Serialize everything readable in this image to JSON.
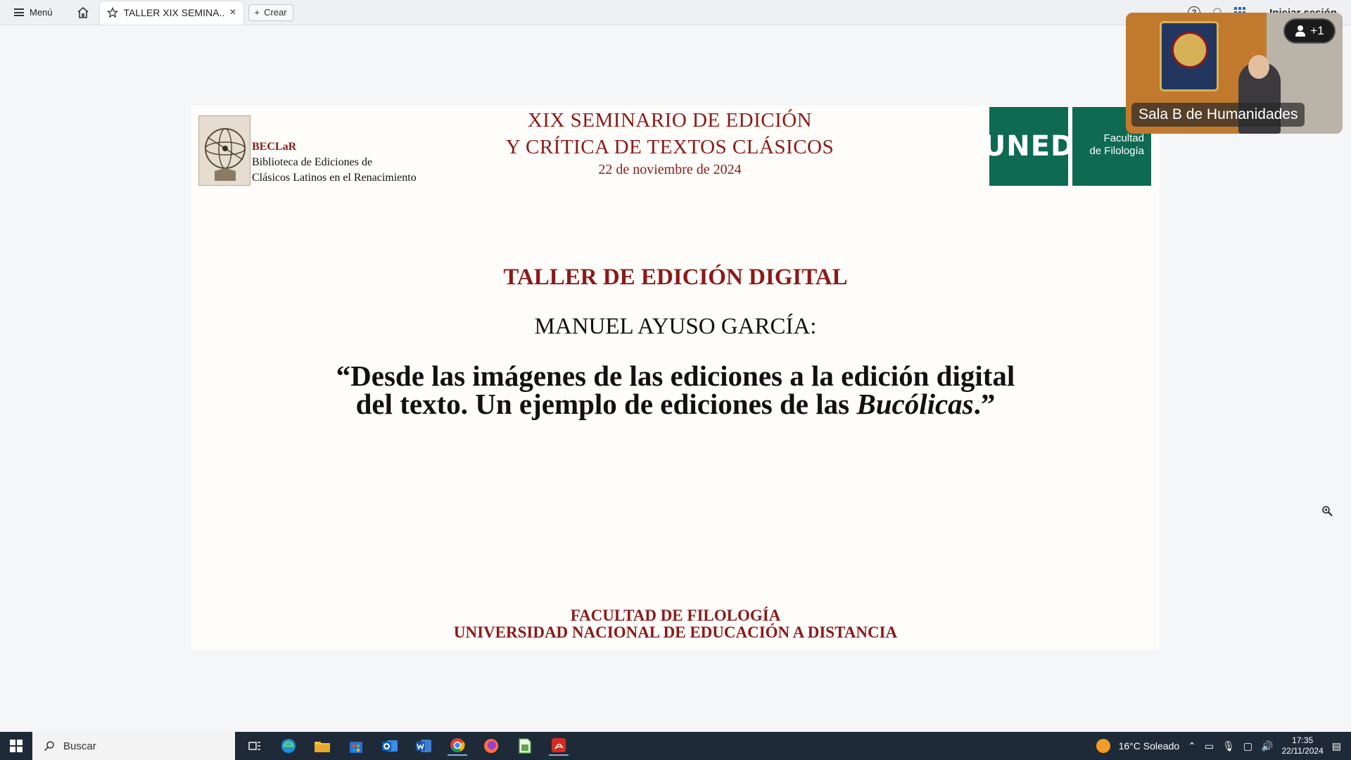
{
  "topbar": {
    "menu_label": "Menú",
    "tab_title": "TALLER XIX SEMINA...",
    "create_label": "Crear",
    "login_label": "Iniciar sesión"
  },
  "slide": {
    "beclar_name": "BECLaR",
    "beclar_line1": "Biblioteca de Ediciones de",
    "beclar_line2": "Clásicos Latinos en el Renacimiento",
    "seminar_line1": "XIX SEMINARIO DE EDICIÓN",
    "seminar_line2": "Y CRÍTICA DE TEXTOS CLÁSICOS",
    "seminar_date": "22 de noviembre de 2024",
    "uned_logo": "UNED",
    "facultad_line1": "Facultad",
    "facultad_line2": "de Filología",
    "workshop_title": "TALLER DE EDICIÓN DIGITAL",
    "speaker": "MANUEL AYUSO GARCÍA:",
    "talk_line1": "“Desde las imágenes de las ediciones a la edición digital",
    "talk_line2_pre": "del texto. Un ejemplo de ediciones de las ",
    "talk_line2_italic": "Bucólicas",
    "talk_line2_post": ".”",
    "footer_line1": "FACULTAD DE FILOLOGÍA",
    "footer_line2": "UNIVERSIDAD NACIONAL DE EDUCACIÓN A DISTANCIA"
  },
  "video": {
    "participants_extra": "+1",
    "room_name": "Sala B de Humanidades"
  },
  "taskbar": {
    "search_placeholder": "Buscar",
    "weather": "16°C  Soleado",
    "time": "17:35",
    "date": "22/11/2024"
  },
  "colors": {
    "accent_red": "#8b1a1a",
    "uned_green": "#0f6a52",
    "taskbar_bg": "#1f2a38"
  }
}
